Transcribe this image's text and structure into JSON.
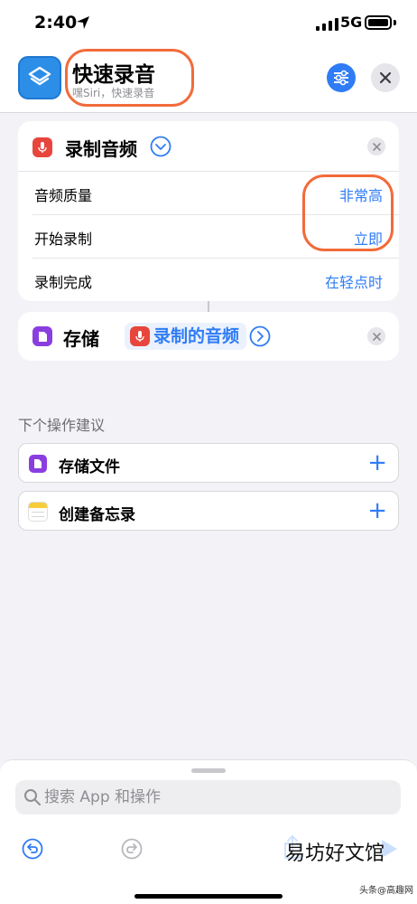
{
  "status_bar": {
    "time": "2:40",
    "network": "5G"
  },
  "header": {
    "title": "快速录音",
    "subtitle": "嘿Siri，快速录音",
    "icons": {
      "app": "shortcuts-app-icon",
      "settings": "sliders-icon",
      "close": "close-icon"
    }
  },
  "actions": [
    {
      "title": "录制音频",
      "icon": "microphone-icon",
      "params": [
        {
          "label": "音频质量",
          "value": "非常高"
        },
        {
          "label": "开始录制",
          "value": "立即"
        },
        {
          "label": "录制完成",
          "value": "在轻点时"
        }
      ]
    },
    {
      "title": "存储",
      "icon": "document-icon",
      "variable": "录制的音频"
    }
  ],
  "suggestions": {
    "heading": "下个操作建议",
    "items": [
      {
        "label": "存储文件",
        "icon": "file-icon"
      },
      {
        "label": "创建备忘录",
        "icon": "notes-icon"
      }
    ]
  },
  "search": {
    "placeholder": "搜索 App 和操作"
  },
  "toolbar": [
    "undo-icon",
    "redo-icon",
    "share-icon",
    "play-icon"
  ],
  "watermark": {
    "text": "易坊好文馆",
    "sub": "头条@高趣网"
  },
  "colors": {
    "accent": "#2f7cf6",
    "highlight": "#f26b3a",
    "mic": "#e8453c",
    "file": "#8a3ee0",
    "background": "#f2f2f7"
  }
}
